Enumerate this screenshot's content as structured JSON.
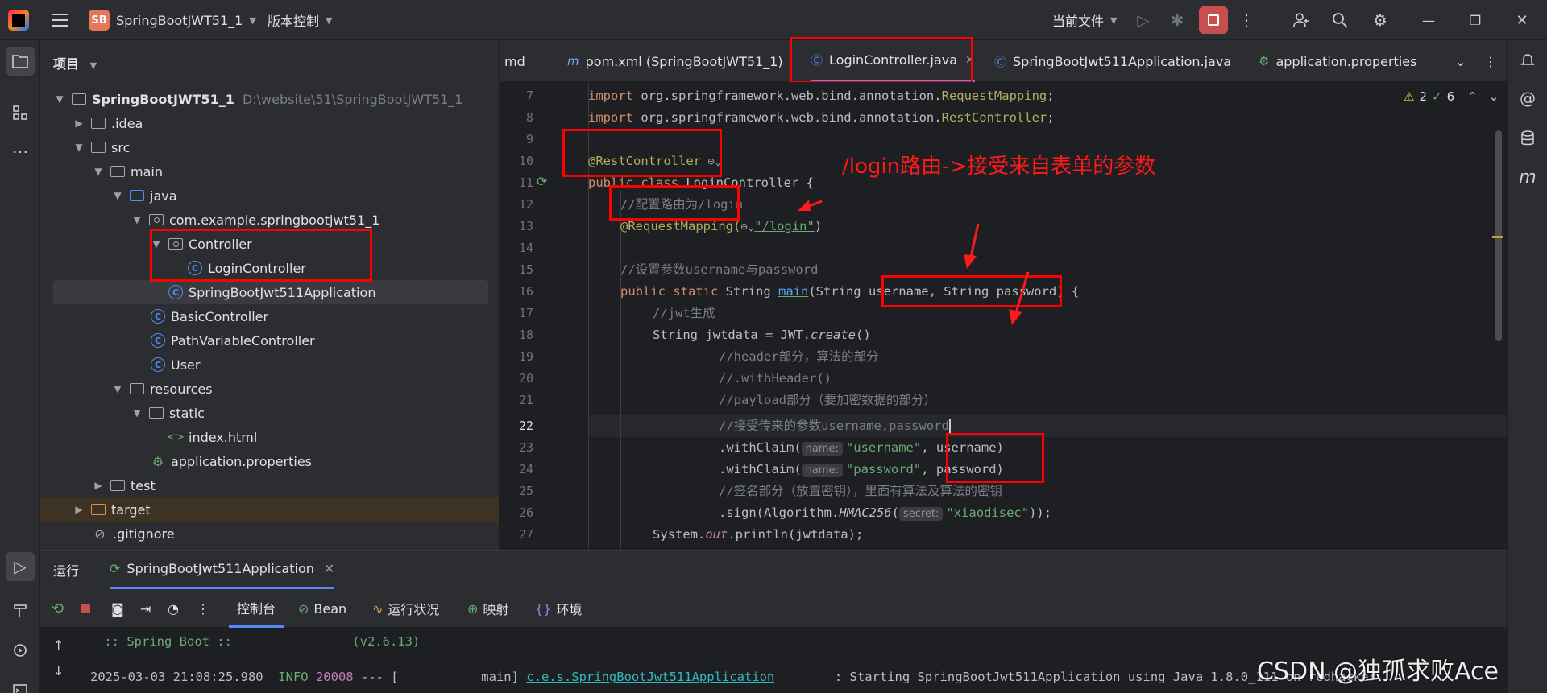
{
  "titlebar": {
    "project_badge": "SB",
    "project_name": "SpringBootJWT51_1",
    "vcs_label": "版本控制",
    "run_config": "当前文件"
  },
  "project_panel": {
    "header": "项目",
    "tree": [
      {
        "label": "SpringBootJWT51_1",
        "path": "D:\\website\\51\\SpringBootJWT51_1"
      },
      {
        "label": ".idea"
      },
      {
        "label": "src"
      },
      {
        "label": "main"
      },
      {
        "label": "java"
      },
      {
        "label": "com.example.springbootjwt51_1"
      },
      {
        "label": "Controller"
      },
      {
        "label": "LoginController"
      },
      {
        "label": "SpringBootJwt511Application"
      },
      {
        "label": "BasicController"
      },
      {
        "label": "PathVariableController"
      },
      {
        "label": "User"
      },
      {
        "label": "resources"
      },
      {
        "label": "static"
      },
      {
        "label": "index.html"
      },
      {
        "label": "application.properties"
      },
      {
        "label": "test"
      },
      {
        "label": "target"
      },
      {
        "label": ".gitignore"
      }
    ]
  },
  "tabs": [
    {
      "label": "md"
    },
    {
      "label": "pom.xml (SpringBootJWT51_1)"
    },
    {
      "label": "LoginController.java"
    },
    {
      "label": "SpringBootJwt511Application.java"
    },
    {
      "label": "application.properties"
    }
  ],
  "editor": {
    "warnings": "2",
    "checks": "6",
    "line_numbers": [
      "7",
      "8",
      "9",
      "10",
      "11",
      "12",
      "13",
      "14",
      "15",
      "16",
      "17",
      "18",
      "19",
      "20",
      "21",
      "22",
      "23",
      "24",
      "25",
      "26",
      "27"
    ],
    "annotation_text": "/login路由->接受来自表单的参数"
  },
  "code": {
    "l7_import": "import ",
    "l7_pkg": "org.springframework.web.bind.annotation.",
    "l7_cls": "RequestMapping",
    "l7_end": ";",
    "l8_import": "import ",
    "l8_pkg": "org.springframework.web.bind.annotation.",
    "l8_cls": "RestController",
    "l8_end": ";",
    "l10": "@RestController",
    "l11_k": "public class ",
    "l11_rest": "LoginController {",
    "l12": "//配置路由为/login",
    "l13_a": "@RequestMapping(",
    "l13_s": "\"/login\"",
    "l13_end": ")",
    "l15": "//设置参数username与password",
    "l16_k": "public static ",
    "l16_type": "String ",
    "l16_fn": "main",
    "l16_args": "(String username, String password) {",
    "l17": "//jwt生成",
    "l18_a": "String ",
    "l18_var": "jwtdata",
    "l18_b": " = JWT.",
    "l18_fn": "create",
    "l18_c": "()",
    "l19": "//header部分，算法的部分",
    "l20": "//.withHeader()",
    "l21": "//payload部分（要加密数据的部分）",
    "l22": "//接受传来的参数username,password",
    "l23_a": ".withClaim(",
    "l23_hint": "name:",
    "l23_s": "\"username\"",
    "l23_b": ", username)",
    "l24_a": ".withClaim(",
    "l24_hint": "name:",
    "l24_s": "\"password\"",
    "l24_b": ", password)",
    "l25": "//签名部分（放置密钥），里面有算法及算法的密钥",
    "l26_a": ".sign(Algorithm.",
    "l26_fn": "HMAC256",
    "l26_b": "(",
    "l26_hint": "secret:",
    "l26_s": "\"xiaodisec\"",
    "l26_c": "));",
    "l27_a": "System.",
    "l27_out": "out",
    "l27_b": ".println(jwtdata);"
  },
  "run": {
    "title": "运行",
    "config_tab": "SpringBootJwt511Application",
    "tabs": [
      "控制台",
      "Bean",
      "运行状况",
      "映射",
      "环境"
    ],
    "console": {
      "banner": " :: Spring Boot ::                (v2.6.13)",
      "ts": "2025-03-03 21:08:25.980  ",
      "level": "INFO ",
      "pid": "20008",
      "sep": " --- [           main] ",
      "logger": "c.e.s.SpringBootJwt511Application",
      "msg": "        : Starting SpringBootJwt511Application using Java 1.8.0_111 on redhacker"
    }
  },
  "watermark": "CSDN @独孤求败Ace"
}
